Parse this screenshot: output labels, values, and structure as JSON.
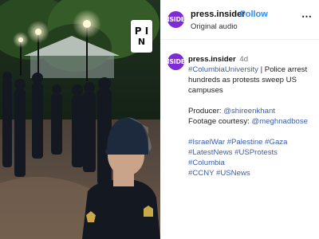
{
  "media": {
    "badge": {
      "row1": "P I",
      "row2": "N"
    },
    "colors": {
      "helmet": "#1d2a3e",
      "uniform": "#141820",
      "badge_gold": "#c8a94a",
      "lamp": "#fff7d6"
    }
  },
  "post": {
    "avatar_text": "INSIDER",
    "account_name": "press.insider",
    "separator": "·",
    "follow_label": "Follow",
    "audio_label": "Original audio",
    "more_icon": "⋯"
  },
  "caption": {
    "username": "press.insider",
    "time_ago": "4d",
    "headline_tag": "#ColumbiaUniversity",
    "headline_text": " | Police arrest hundreds as protests sweep US campuses",
    "producer_label": "Producer: ",
    "producer_handle": "@shireenkhant",
    "footage_label": "Footage courtesy: ",
    "footage_handle": "@meghnadbose",
    "hashtags_line1": "#IsraelWar #Palestine #Gaza",
    "hashtags_line2": "#LatestNews #USProtests #Columbia",
    "hashtags_line3": "#CCNY #USNews"
  }
}
